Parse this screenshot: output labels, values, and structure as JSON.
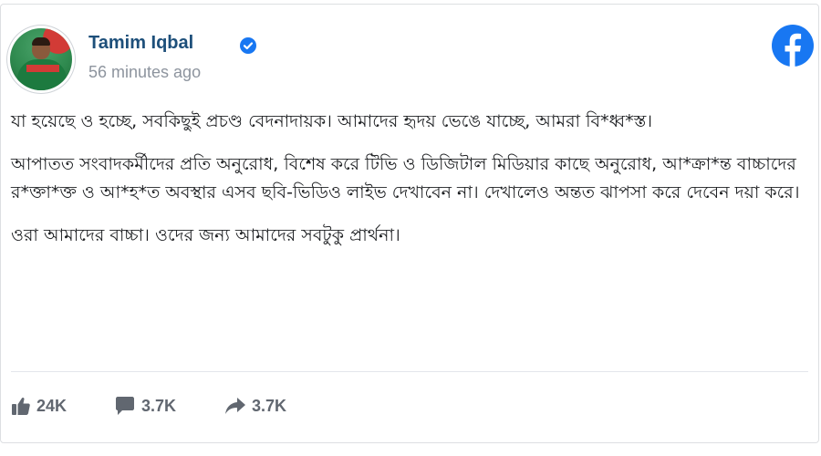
{
  "post": {
    "author_name": "Tamim Iqbal",
    "verified_icon": "verified-badge-icon",
    "timestamp": "56 minutes ago",
    "platform_icon": "facebook-logo-icon",
    "paragraphs": [
      "যা হয়েছে ও হচ্ছে, সবকিছুই প্রচণ্ড বেদনাদায়ক। আমাদের হৃদয় ভেঙে যাচ্ছে, আমরা বি*ধ্ব*স্ত।",
      "আপাতত সংবাদকর্মীদের প্রতি অনুরোধ, বিশেষ করে টিভি ও ডিজিটাল মিডিয়ার কাছে অনুরোধ, আ*ক্রা*ন্ত বাচ্চাদের র*ক্তা*ক্ত ও আ*হ*ত অবস্থার এসব ছবি-ভিডিও লাইভ দেখাবেন না। দেখালেও অন্তত ঝাপসা করে দেবেন দয়া করে।",
      "ওরা আমাদের বাচ্চা। ওদের জন্য আমাদের সবটুকু প্রার্থনা।"
    ]
  },
  "stats": {
    "likes": "24K",
    "comments": "3.7K",
    "shares": "3.7K"
  },
  "colors": {
    "author": "#1d4f7a",
    "facebook_blue": "#1877f2",
    "muted": "#8d949e",
    "stat_text": "#616770"
  }
}
